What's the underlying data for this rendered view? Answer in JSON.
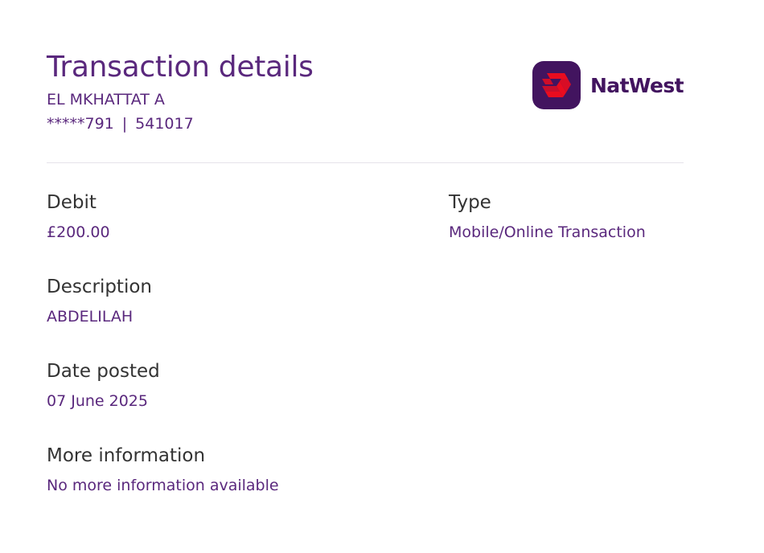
{
  "header": {
    "title": "Transaction details",
    "account_name": "EL MKHATTAT A",
    "account_number": "*****791",
    "separator": "|",
    "sort_code": "541017",
    "brand": {
      "name": "NatWest",
      "logo_icon": "natwest-cubes-icon",
      "tile_color": "#42145f",
      "cube_color": "#e90c1f"
    }
  },
  "details": {
    "debit": {
      "label": "Debit",
      "value": "£200.00"
    },
    "type": {
      "label": "Type",
      "value": "Mobile/Online Transaction"
    },
    "description": {
      "label": "Description",
      "value": "ABDELILAH"
    },
    "date_posted": {
      "label": "Date posted",
      "value": "07 June 2025"
    },
    "more_information": {
      "label": "More information",
      "value": "No more information available"
    }
  },
  "colors": {
    "accent": "#5a287d",
    "label": "#333333",
    "divider": "#e6e3ea"
  }
}
